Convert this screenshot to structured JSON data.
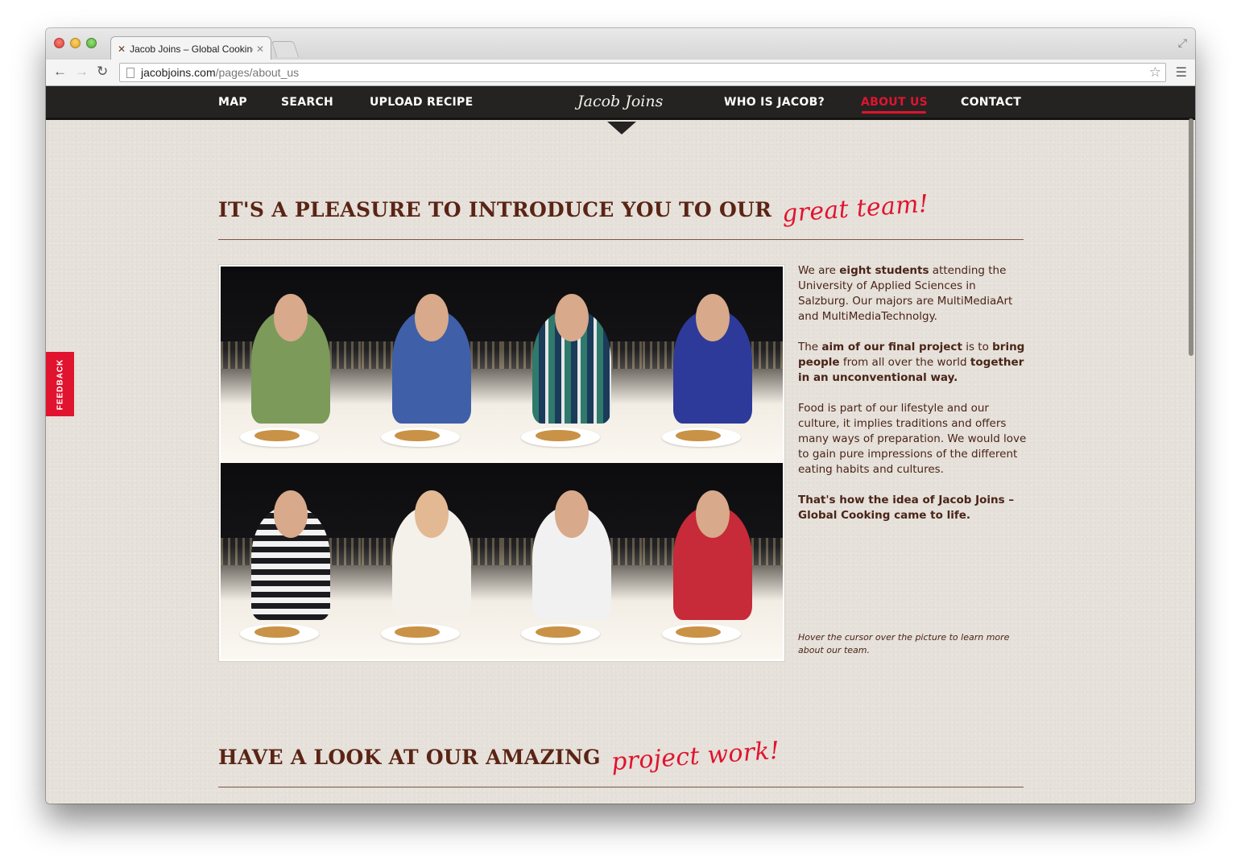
{
  "browser": {
    "tab_title": "Jacob Joins – Global Cooking",
    "url_domain": "jacobjoins.com",
    "url_path": "/pages/about_us",
    "icons": [
      "back-icon",
      "forward-icon",
      "reload-icon",
      "star-icon",
      "menu-icon",
      "close-icon",
      "fullscreen-icon"
    ]
  },
  "nav": {
    "logo": "Jacob Joins",
    "items": [
      {
        "label": "MAP"
      },
      {
        "label": "SEARCH"
      },
      {
        "label": "UPLOAD RECIPE"
      },
      {
        "label": "WHO IS JACOB?"
      },
      {
        "label": "ABOUT US",
        "active": true
      },
      {
        "label": "CONTACT"
      }
    ]
  },
  "feedback": {
    "label": "FEEDBACK"
  },
  "team_section": {
    "heading": "IT'S A PLEASURE TO INTRODUCE YOU TO OUR",
    "heading_accent": "great team!",
    "para1": {
      "t1": "We are ",
      "b1": "eight students",
      "t2": " attending the University of Applied Sciences in Salzburg. Our majors are MultiMediaArt and MultiMediaTechnolgy."
    },
    "para2": {
      "t1": "The ",
      "b1": "aim of our final project",
      "t2": " is to ",
      "b2": "bring people",
      "t3": " from all over the world ",
      "b3": "together in an unconventional way."
    },
    "para3": "Food is part of our lifestyle and our culture, it implies traditions and offers many ways of preparation. We would love to gain pure impressions of the different eating habits and cultures.",
    "para4": "That's how the idea of Jacob Joins – Global Cooking came to life.",
    "hover_hint": "Hover the cursor over the picture to learn more about our team."
  },
  "project_section": {
    "heading": "HAVE A LOOK AT OUR AMAZING",
    "heading_accent": "project work!"
  },
  "colors": {
    "accent_red": "#e0142f",
    "heading_brown": "#5a2415",
    "nav_bg": "#252322",
    "paper_bg": "#e6e1da"
  }
}
